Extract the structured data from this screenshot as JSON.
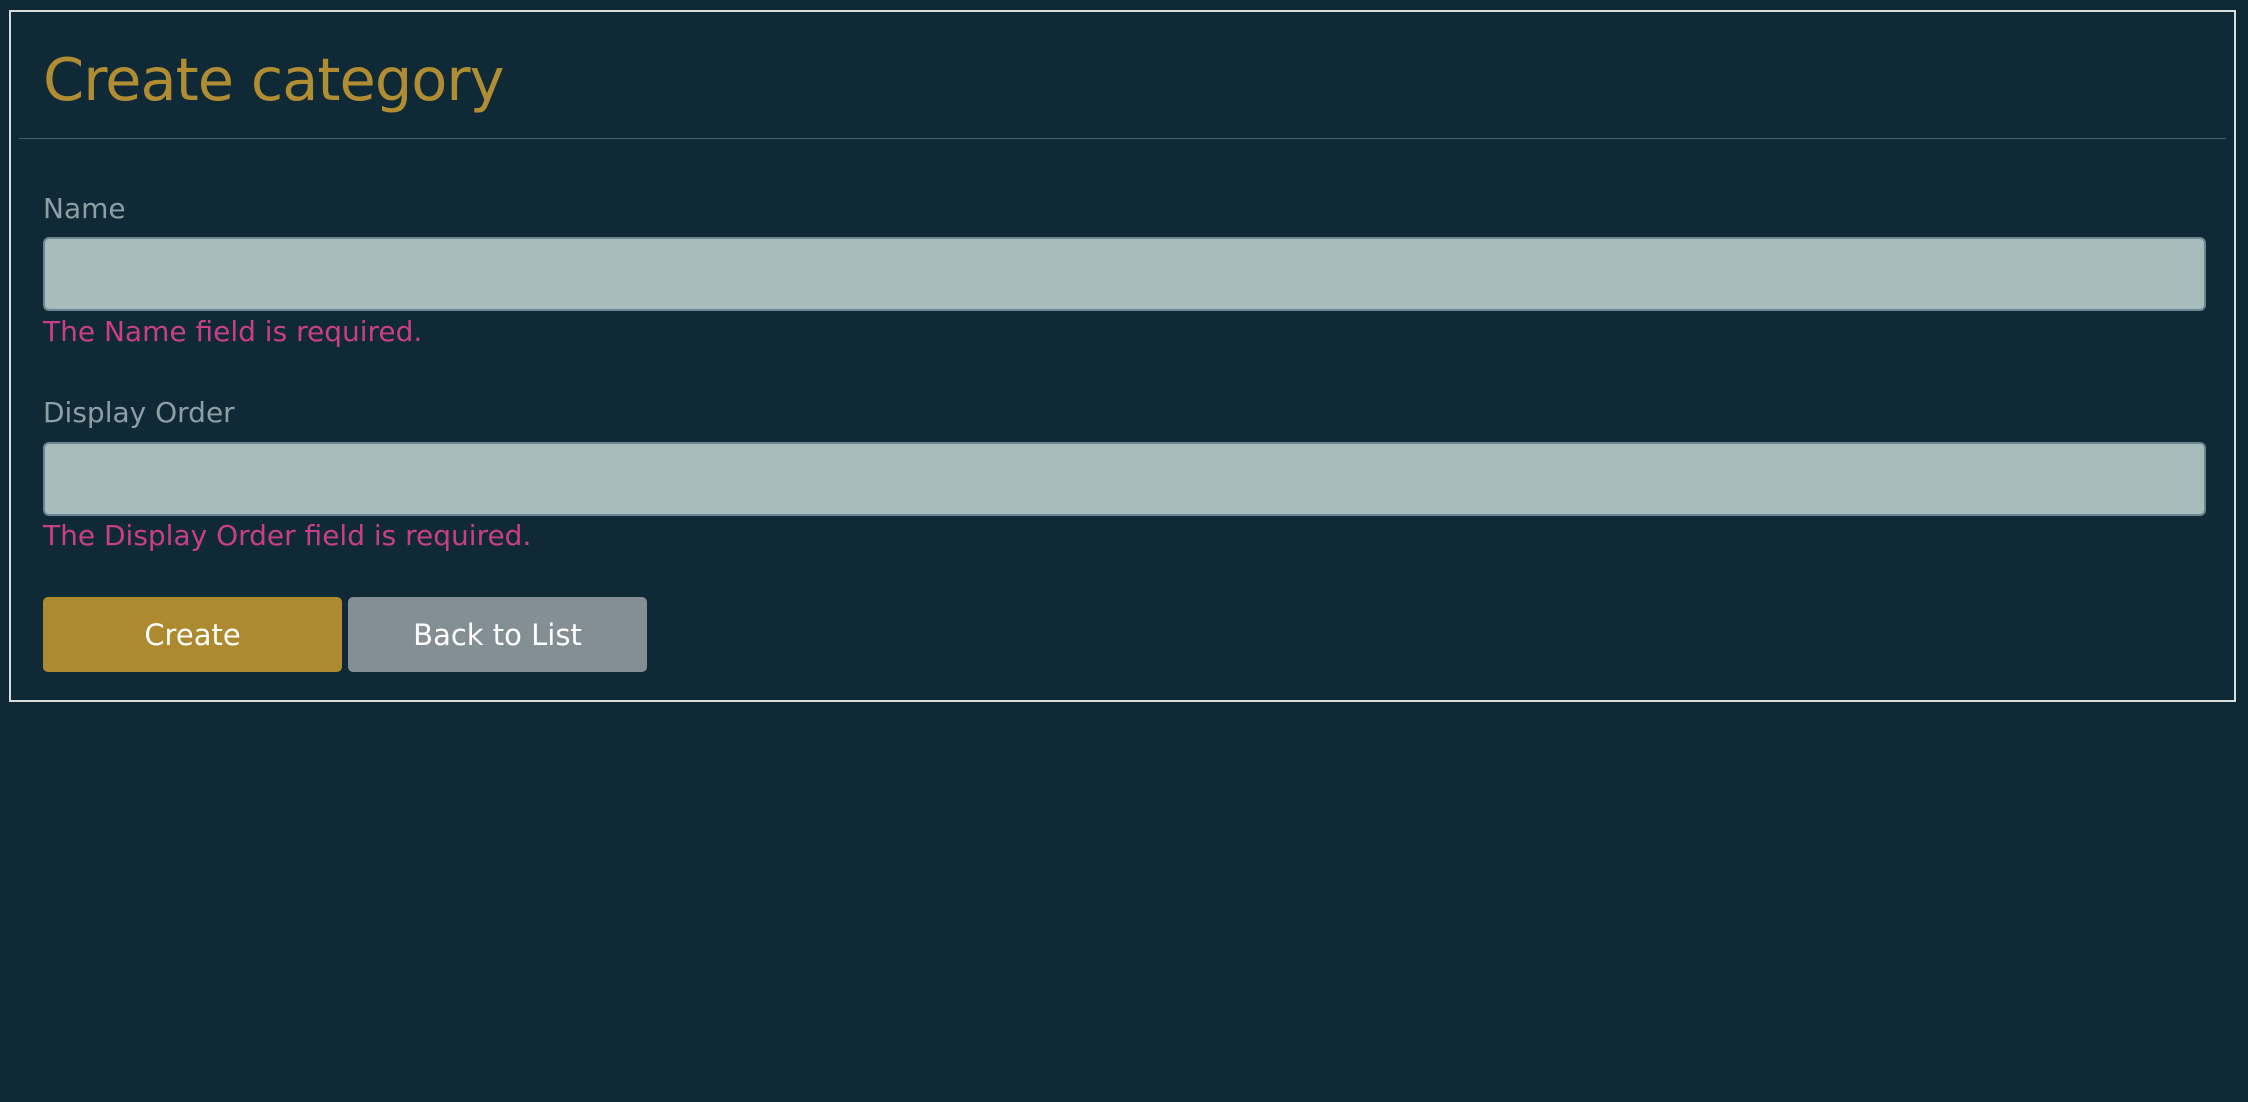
{
  "page": {
    "title": "Create category"
  },
  "form": {
    "name": {
      "label": "Name",
      "value": "",
      "error": "The Name field is required."
    },
    "display_order": {
      "label": "Display Order",
      "value": "",
      "error": "The Display Order field is required."
    }
  },
  "actions": {
    "create_label": "Create",
    "back_label": "Back to List"
  },
  "colors": {
    "background": "#0f2a36",
    "title": "#b08d33",
    "label": "#8f9ea5",
    "input_bg": "#a9bcbd",
    "error": "#c83e88",
    "create_button": "#ad8a30",
    "back_button": "#848f95"
  }
}
